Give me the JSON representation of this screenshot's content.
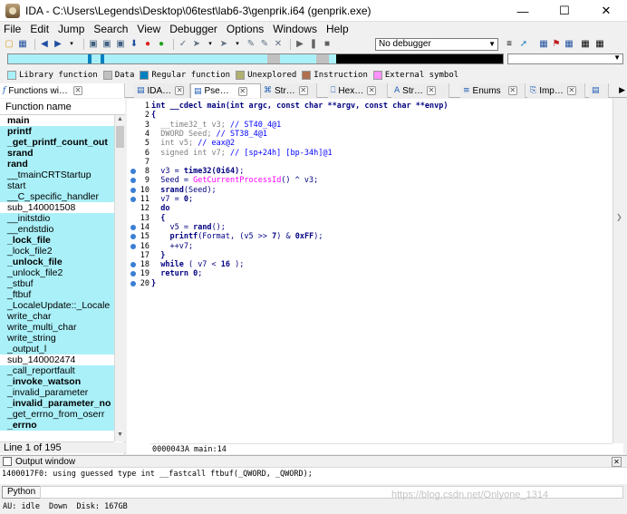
{
  "window": {
    "title": "IDA - C:\\Users\\Legends\\Desktop\\06test\\lab6-3\\genprik.i64 (genprik.exe)",
    "minimize": "—",
    "maximize": "☐",
    "close": "✕"
  },
  "menu": [
    "File",
    "Edit",
    "Jump",
    "Search",
    "View",
    "Debugger",
    "Options",
    "Windows",
    "Help"
  ],
  "toolbar": {
    "debugger_label": "No debugger"
  },
  "legend": [
    {
      "label": "Library function",
      "color": "#aaf0f8"
    },
    {
      "label": "Data",
      "color": "#c0c0c0"
    },
    {
      "label": "Regular function",
      "color": "#0080c0"
    },
    {
      "label": "Unexplored",
      "color": "#b0b070"
    },
    {
      "label": "Instruction",
      "color": "#b07050"
    },
    {
      "label": "External symbol",
      "color": "#ff90ff"
    }
  ],
  "tabs": [
    {
      "label": "Functions wi…",
      "icon": "f"
    },
    {
      "label": "IDA…",
      "icon": "▤"
    },
    {
      "label": "Pse…",
      "icon": "▤"
    },
    {
      "label": "Str…",
      "icon": "⌘"
    },
    {
      "label": "Hex…",
      "icon": "⎕"
    },
    {
      "label": "Str…",
      "icon": "A"
    },
    {
      "label": "Enums",
      "icon": "≡"
    },
    {
      "label": "Imp…",
      "icon": "⎘"
    }
  ],
  "functions": {
    "header": "Function name",
    "items": [
      {
        "name": "main",
        "bold": true,
        "lib": false
      },
      {
        "name": "printf",
        "bold": true,
        "lib": true
      },
      {
        "name": "_get_printf_count_out",
        "bold": true,
        "lib": true
      },
      {
        "name": "srand",
        "bold": true,
        "lib": true
      },
      {
        "name": "rand",
        "bold": true,
        "lib": true
      },
      {
        "name": "__tmainCRTStartup",
        "bold": false,
        "lib": true
      },
      {
        "name": "start",
        "bold": false,
        "lib": true
      },
      {
        "name": "__C_specific_handler",
        "bold": false,
        "lib": true
      },
      {
        "name": "sub_140001508",
        "bold": false,
        "lib": false
      },
      {
        "name": "__initstdio",
        "bold": false,
        "lib": true
      },
      {
        "name": "__endstdio",
        "bold": false,
        "lib": true
      },
      {
        "name": "_lock_file",
        "bold": true,
        "lib": true
      },
      {
        "name": "_lock_file2",
        "bold": false,
        "lib": true
      },
      {
        "name": "_unlock_file",
        "bold": true,
        "lib": true
      },
      {
        "name": "_unlock_file2",
        "bold": false,
        "lib": true
      },
      {
        "name": "_stbuf",
        "bold": false,
        "lib": true
      },
      {
        "name": "_ftbuf",
        "bold": false,
        "lib": true
      },
      {
        "name": "_LocaleUpdate::_Locale",
        "bold": false,
        "lib": true
      },
      {
        "name": "write_char",
        "bold": false,
        "lib": true
      },
      {
        "name": "write_multi_char",
        "bold": false,
        "lib": true
      },
      {
        "name": "write_string",
        "bold": false,
        "lib": true
      },
      {
        "name": "_output_l",
        "bold": false,
        "lib": true
      },
      {
        "name": "sub_140002474",
        "bold": false,
        "lib": false
      },
      {
        "name": "_call_reportfault",
        "bold": false,
        "lib": true
      },
      {
        "name": "_invoke_watson",
        "bold": true,
        "lib": true
      },
      {
        "name": "_invalid_parameter",
        "bold": false,
        "lib": true
      },
      {
        "name": "_invalid_parameter_no",
        "bold": true,
        "lib": true
      },
      {
        "name": "_get_errno_from_oserr",
        "bold": false,
        "lib": true
      },
      {
        "name": "_errno",
        "bold": true,
        "lib": true
      }
    ],
    "status": "Line 1 of 195"
  },
  "code": {
    "lines": [
      {
        "n": "1",
        "bp": false,
        "html": [
          [
            "kw",
            "int __cdecl main(int argc, const char **argv, const char **envp)"
          ]
        ]
      },
      {
        "n": "2",
        "bp": false,
        "html": [
          [
            "kw",
            "{"
          ]
        ]
      },
      {
        "n": "3",
        "bp": false,
        "html": [
          [
            "dec",
            "  __time32_t v3; "
          ],
          [
            "com",
            "// ST40_4@1"
          ]
        ]
      },
      {
        "n": "4",
        "bp": false,
        "html": [
          [
            "dec",
            "  DWORD Seed; "
          ],
          [
            "com",
            "// ST38_4@1"
          ]
        ]
      },
      {
        "n": "5",
        "bp": false,
        "html": [
          [
            "dec",
            "  int v5; "
          ],
          [
            "com",
            "// eax@2"
          ]
        ]
      },
      {
        "n": "6",
        "bp": false,
        "html": [
          [
            "dec",
            "  signed int v7; "
          ],
          [
            "com",
            "// [sp+24h] [bp-34h]@1"
          ]
        ]
      },
      {
        "n": "7",
        "bp": false,
        "html": [
          [
            "plain",
            ""
          ]
        ]
      },
      {
        "n": "8",
        "bp": true,
        "html": [
          [
            "var",
            "  v3"
          ],
          [
            "plain",
            " = "
          ],
          [
            "fun",
            "time32(0i64)"
          ],
          [
            "plain",
            ";"
          ]
        ]
      },
      {
        "n": "9",
        "bp": true,
        "html": [
          [
            "var",
            "  Seed"
          ],
          [
            "plain",
            " = "
          ],
          [
            "imp",
            "GetCurrentProcessId"
          ],
          [
            "plain",
            "() ^ "
          ],
          [
            "var",
            "v3"
          ],
          [
            "plain",
            ";"
          ]
        ]
      },
      {
        "n": "10",
        "bp": true,
        "html": [
          [
            "fun",
            "  srand"
          ],
          [
            "plain",
            "("
          ],
          [
            "var",
            "Seed"
          ],
          [
            "plain",
            ");"
          ]
        ]
      },
      {
        "n": "11",
        "bp": true,
        "html": [
          [
            "var",
            "  v7"
          ],
          [
            "plain",
            " = "
          ],
          [
            "fun",
            "0"
          ],
          [
            "plain",
            ";"
          ]
        ]
      },
      {
        "n": "12",
        "bp": false,
        "html": [
          [
            "kw",
            "  do"
          ]
        ]
      },
      {
        "n": "13",
        "bp": false,
        "html": [
          [
            "kw",
            "  {"
          ]
        ]
      },
      {
        "n": "14",
        "bp": true,
        "html": [
          [
            "var",
            "    v5"
          ],
          [
            "plain",
            " = "
          ],
          [
            "fun",
            "rand"
          ],
          [
            "plain",
            "();"
          ]
        ]
      },
      {
        "n": "15",
        "bp": true,
        "html": [
          [
            "fun",
            "    printf"
          ],
          [
            "plain",
            "(Format, ("
          ],
          [
            "var",
            "v5"
          ],
          [
            "plain",
            " >> "
          ],
          [
            "fun",
            "7"
          ],
          [
            "plain",
            ") & "
          ],
          [
            "fun",
            "0xFF"
          ],
          [
            "plain",
            ");"
          ]
        ]
      },
      {
        "n": "16",
        "bp": true,
        "html": [
          [
            "plain",
            "    ++"
          ],
          [
            "var",
            "v7"
          ],
          [
            "plain",
            ";"
          ]
        ]
      },
      {
        "n": "17",
        "bp": false,
        "html": [
          [
            "kw",
            "  }"
          ]
        ]
      },
      {
        "n": "18",
        "bp": true,
        "html": [
          [
            "kw",
            "  while"
          ],
          [
            "plain",
            " ( "
          ],
          [
            "var",
            "v7"
          ],
          [
            "plain",
            " < "
          ],
          [
            "fun",
            "16"
          ],
          [
            "plain",
            " );"
          ]
        ]
      },
      {
        "n": "19",
        "bp": true,
        "html": [
          [
            "kw",
            "  return"
          ],
          [
            "plain",
            " "
          ],
          [
            "fun",
            "0"
          ],
          [
            "plain",
            ";"
          ]
        ]
      },
      {
        "n": "20",
        "bp": true,
        "html": [
          [
            "kw",
            "}"
          ]
        ]
      }
    ],
    "status": "0000043A main:14"
  },
  "output": {
    "title": "Output window",
    "text": "1400017F0: using guessed type int __fastcall ftbuf(_QWORD, _QWORD);",
    "python_label": "Python"
  },
  "statusbar": {
    "au": "AU:  idle",
    "down": "Down",
    "disk": "Disk: 167GB"
  },
  "watermark": "https://blog.csdn.net/Onlyone_1314"
}
